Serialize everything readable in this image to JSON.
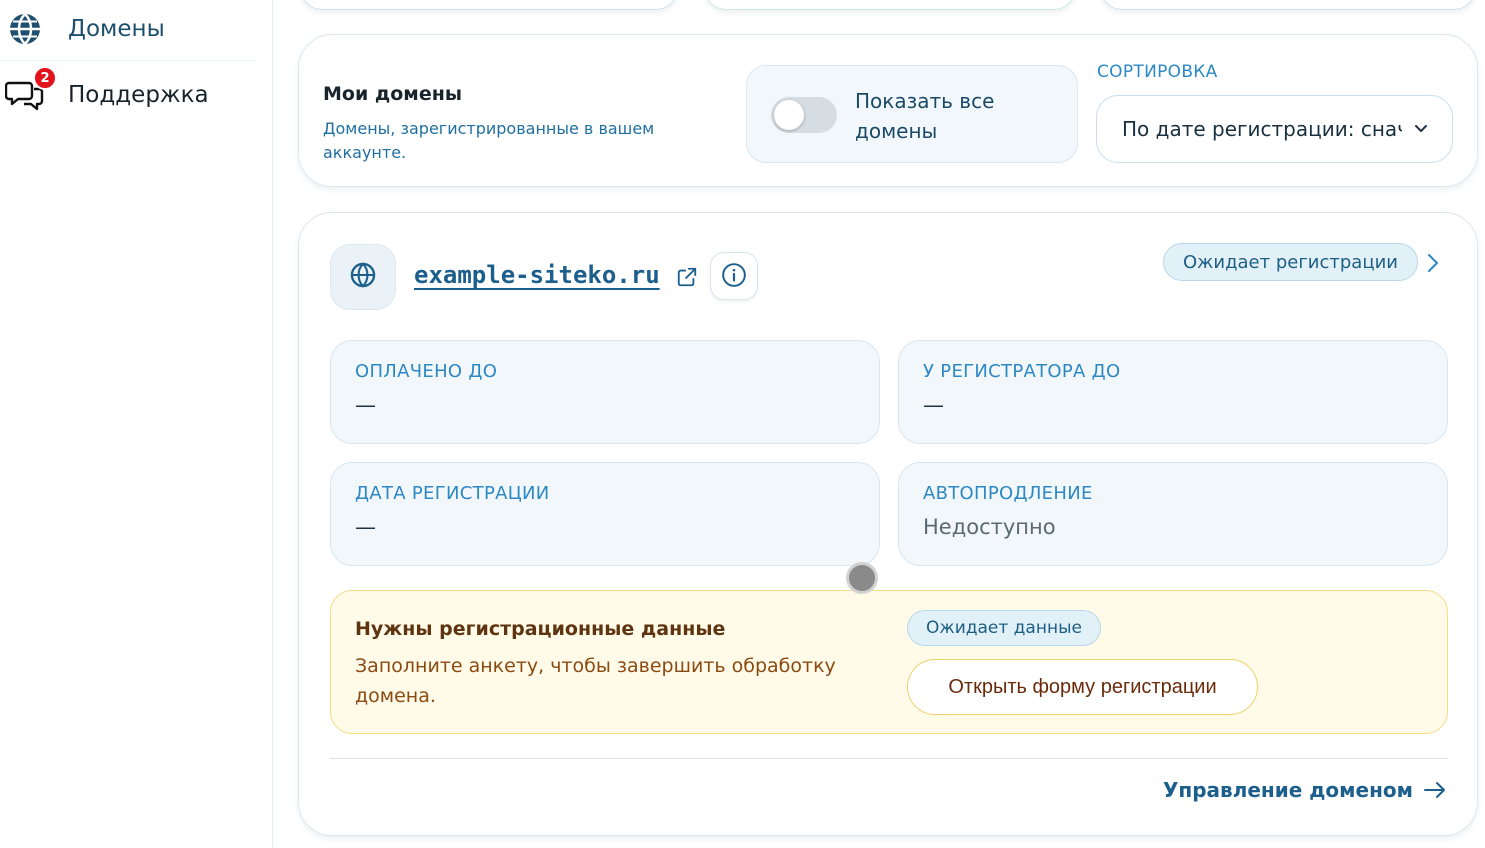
{
  "sidebar": {
    "items": [
      {
        "label": "Домены",
        "icon": "globe-icon",
        "active": true
      },
      {
        "label": "Поддержка",
        "icon": "chat-bubbles-icon",
        "badge": "2"
      }
    ]
  },
  "header": {
    "title": "Мои домены",
    "subtitle": "Домены, зарегистрированные в вашем аккаунте.",
    "toggle": {
      "label": "Показать все домены",
      "checked": false
    },
    "sort": {
      "label": "СОРТИРОВКА",
      "value": "По дате регистрации: снач"
    }
  },
  "domain": {
    "name": "example-siteko.ru",
    "status": "Ожидает регистрации",
    "fields": [
      {
        "label": "ОПЛАЧЕНО ДО",
        "value": "—"
      },
      {
        "label": "У РЕГИСТРАТОРА ДО",
        "value": "—"
      },
      {
        "label": "ДАТА РЕГИСТРАЦИИ",
        "value": "—"
      },
      {
        "label": "АВТОПРОДЛЕНИЕ",
        "value": "Недоступно"
      }
    ],
    "notice": {
      "title": "Нужны регистрационные данные",
      "text": "Заполните анкету, чтобы завершить обработку домена.",
      "status": "Ожидает данные",
      "button": "Открыть форму регистрации"
    },
    "manage_link": "Управление доменом"
  },
  "colors": {
    "accent": "#1d5f8c",
    "label_blue": "#2d88c4",
    "badge_red": "#e2131c",
    "warning_bg": "#fffbe8",
    "warning_border": "#f5dc87"
  }
}
